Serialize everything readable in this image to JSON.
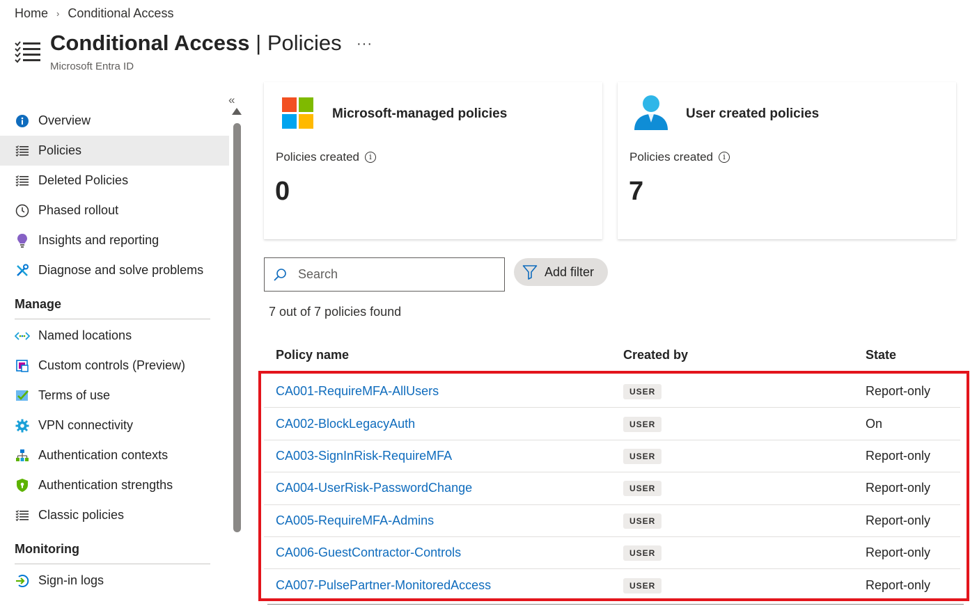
{
  "breadcrumb": {
    "home": "Home",
    "separator": "›",
    "current": "Conditional Access"
  },
  "header": {
    "title_main": "Conditional Access",
    "title_sep": " | ",
    "title_section": "Policies",
    "more": "···",
    "subtitle": "Microsoft Entra ID"
  },
  "sidebar": {
    "collapse_glyph": "«",
    "items": [
      {
        "label": "Overview",
        "icon": "info-icon",
        "active": false
      },
      {
        "label": "Policies",
        "icon": "list-icon",
        "active": true
      },
      {
        "label": "Deleted Policies",
        "icon": "list-icon",
        "active": false
      },
      {
        "label": "Phased rollout",
        "icon": "clock-icon",
        "active": false
      },
      {
        "label": "Insights and reporting",
        "icon": "lightbulb-icon",
        "active": false
      },
      {
        "label": "Diagnose and solve problems",
        "icon": "wrench-icon",
        "active": false
      }
    ],
    "manage_heading": "Manage",
    "manage_items": [
      {
        "label": "Named locations",
        "icon": "location-arrows-icon"
      },
      {
        "label": "Custom controls (Preview)",
        "icon": "custom-controls-icon"
      },
      {
        "label": "Terms of use",
        "icon": "terms-checkmark-icon"
      },
      {
        "label": "VPN connectivity",
        "icon": "gear-icon"
      },
      {
        "label": "Authentication contexts",
        "icon": "hierarchy-icon"
      },
      {
        "label": "Authentication strengths",
        "icon": "shield-icon"
      },
      {
        "label": "Classic policies",
        "icon": "list-icon"
      }
    ],
    "monitoring_heading": "Monitoring",
    "monitoring_items": [
      {
        "label": "Sign-in logs",
        "icon": "sign-in-arrow-icon"
      }
    ]
  },
  "cards": [
    {
      "title": "Microsoft-managed policies",
      "subtitle": "Policies created",
      "info": "i",
      "value": "0",
      "icon": "microsoft-logo-icon"
    },
    {
      "title": "User created policies",
      "subtitle": "Policies created",
      "info": "i",
      "value": "7",
      "icon": "user-icon"
    }
  ],
  "search": {
    "placeholder": "Search",
    "value": ""
  },
  "filter": {
    "label": "Add filter"
  },
  "result_count": "7 out of 7 policies found",
  "table": {
    "columns": [
      "Policy name",
      "Created by",
      "State"
    ],
    "rows": [
      {
        "name": "CA001-RequireMFA-AllUsers",
        "created_by": "USER",
        "state": "Report-only"
      },
      {
        "name": "CA002-BlockLegacyAuth",
        "created_by": "USER",
        "state": "On"
      },
      {
        "name": "CA003-SignInRisk-RequireMFA",
        "created_by": "USER",
        "state": "Report-only"
      },
      {
        "name": "CA004-UserRisk-PasswordChange",
        "created_by": "USER",
        "state": "Report-only"
      },
      {
        "name": "CA005-RequireMFA-Admins",
        "created_by": "USER",
        "state": "Report-only"
      },
      {
        "name": "CA006-GuestContractor-Controls",
        "created_by": "USER",
        "state": "Report-only"
      },
      {
        "name": "CA007-PulsePartner-MonitoredAccess",
        "created_by": "USER",
        "state": "Report-only"
      }
    ]
  },
  "colors": {
    "link": "#0f6cbd",
    "highlight": "#e3151c",
    "active_nav": "#ebebeb"
  }
}
